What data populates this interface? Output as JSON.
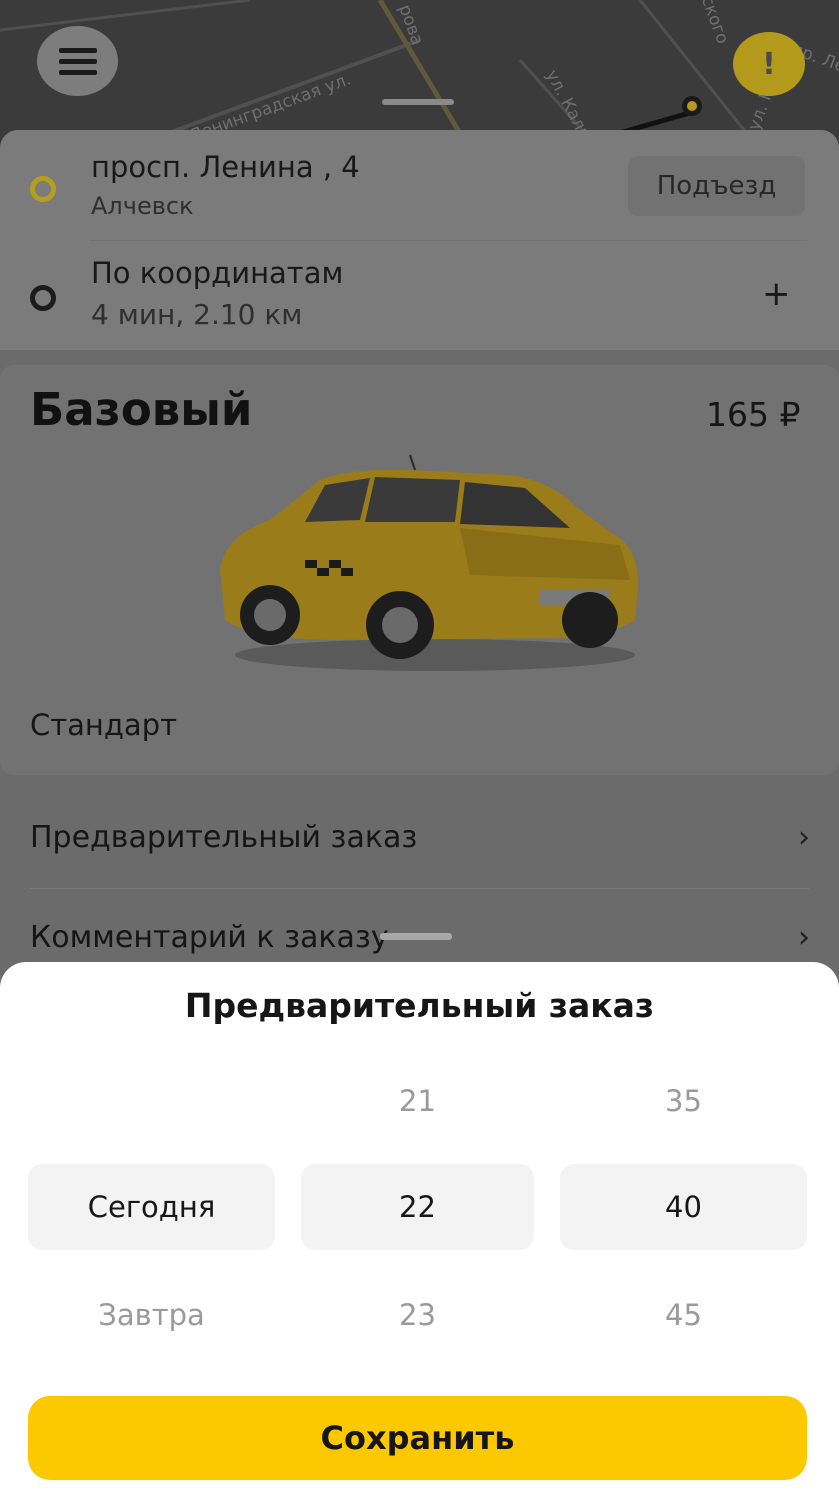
{
  "map": {
    "streets": [
      "Ленинградская ул.",
      "ул. Кали",
      "рова",
      "ского",
      "ул. Г",
      "пр. Лен"
    ]
  },
  "header": {
    "alert_symbol": "!"
  },
  "route": {
    "from_address": "просп. Ленина , 4",
    "from_city": "Алчевск",
    "entrance_label": "Подъезд",
    "to_address": "По координатам",
    "to_info": "4 мин, 2.10 км",
    "add_stop_symbol": "+"
  },
  "tariff": {
    "name": "Базовый",
    "price": "165 ₽",
    "class": "Стандарт"
  },
  "options": {
    "preorder_label": "Предварительный заказ",
    "comment_label": "Комментарий к заказу",
    "chevron": "›"
  },
  "modal": {
    "title": "Предварительный заказ",
    "day": {
      "selected": "Сегодня",
      "next": "Завтра"
    },
    "hour": {
      "prev": "21",
      "selected": "22",
      "next": "23"
    },
    "minute": {
      "prev": "35",
      "selected": "40",
      "next": "45"
    },
    "save_label": "Сохранить"
  },
  "colors": {
    "accent": "#fcc900",
    "dim_overlay": "#6b6b6b"
  }
}
